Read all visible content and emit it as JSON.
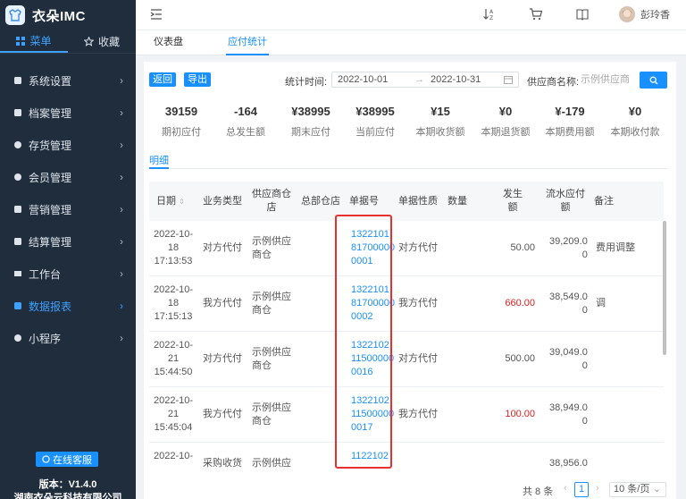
{
  "app": {
    "name": "衣朵IMC"
  },
  "sidebar": {
    "tabs": [
      {
        "label": "菜单",
        "icon": "grid-icon"
      },
      {
        "label": "收藏",
        "icon": "star-icon"
      }
    ],
    "items": [
      {
        "label": "系统设置",
        "icon": "settings-icon"
      },
      {
        "label": "档案管理",
        "icon": "archive-icon"
      },
      {
        "label": "存货管理",
        "icon": "inventory-icon"
      },
      {
        "label": "会员管理",
        "icon": "member-icon"
      },
      {
        "label": "营销管理",
        "icon": "marketing-icon"
      },
      {
        "label": "结算管理",
        "icon": "settlement-icon"
      },
      {
        "label": "工作台",
        "icon": "workbench-icon"
      },
      {
        "label": "数据报表",
        "icon": "report-icon"
      },
      {
        "label": "小程序",
        "icon": "miniprogram-icon"
      }
    ],
    "active_item": "数据报表",
    "support_label": "在线客服",
    "version": "版本：V1.4.0",
    "company": "湖南衣朵云科技有限公司"
  },
  "header": {
    "user_name": "彭玲香"
  },
  "page_tabs": [
    {
      "label": "仪表盘"
    },
    {
      "label": "应付统计"
    }
  ],
  "toolbar": {
    "back_label": "返回",
    "export_label": "导出",
    "period_label": "统计时间:",
    "date_start": "2022-10-01",
    "date_end": "2022-10-31",
    "supplier_label": "供应商名称:",
    "supplier_placeholder": "示例供应商"
  },
  "stats": [
    {
      "value": "39159",
      "label": "期初应付"
    },
    {
      "value": "-164",
      "label": "总发生额"
    },
    {
      "value": "¥38995",
      "label": "期末应付"
    },
    {
      "value": "¥38995",
      "label": "当前应付"
    },
    {
      "value": "¥15",
      "label": "本期收货额"
    },
    {
      "value": "¥0",
      "label": "本期退货额"
    },
    {
      "value": "¥-179",
      "label": "本期费用额"
    },
    {
      "value": "¥0",
      "label": "本期收付款"
    }
  ],
  "detail_tab": "明细",
  "table": {
    "columns": {
      "date": "日期",
      "biz_type": "业务类型",
      "supplier": "供应商仓店",
      "hq_store": "总部仓店",
      "doc_no": "单据号",
      "doc_type": "单据性质",
      "qty": "数量",
      "amount": "发生额",
      "balance": "流水应付额",
      "remark": "备注"
    },
    "rows": [
      {
        "date": [
          "2022-10-",
          "18",
          "17:13:53"
        ],
        "biz_type": "对方代付",
        "supplier": [
          "示例供应",
          "商仓"
        ],
        "doc_no": [
          "1322101",
          "81700000",
          "0001"
        ],
        "doc_type": "对方代付",
        "amount": "50.00",
        "amount_negative": false,
        "balance": [
          "39,209.0",
          "0"
        ],
        "remark": "费用调整"
      },
      {
        "date": [
          "2022-10-",
          "18",
          "17:15:13"
        ],
        "biz_type": "我方代付",
        "supplier": [
          "示例供应",
          "商仓"
        ],
        "doc_no": [
          "1322101",
          "81700000",
          "0002"
        ],
        "doc_type": "我方代付",
        "amount": "660.00",
        "amount_negative": true,
        "balance": [
          "38,549.0",
          "0"
        ],
        "remark": "调"
      },
      {
        "date": [
          "2022-10-",
          "21",
          "15:44:50"
        ],
        "biz_type": "对方代付",
        "supplier": [
          "示例供应",
          "商仓"
        ],
        "doc_no": [
          "1322102",
          "11500000",
          "0016"
        ],
        "doc_type": "对方代付",
        "amount": "500.00",
        "amount_negative": false,
        "balance": [
          "39,049.0",
          "0"
        ],
        "remark": ""
      },
      {
        "date": [
          "2022-10-",
          "21",
          "15:45:04"
        ],
        "biz_type": "我方代付",
        "supplier": [
          "示例供应",
          "商仓"
        ],
        "doc_no": [
          "1322102",
          "11500000",
          "0017"
        ],
        "doc_type": "我方代付",
        "amount": "100.00",
        "amount_negative": true,
        "balance": [
          "38,949.0",
          "0"
        ],
        "remark": ""
      },
      {
        "date": [
          "2022-10-",
          "",
          ""
        ],
        "biz_type": "采购收货",
        "supplier": [
          "示例供应",
          ""
        ],
        "doc_no": [
          "1122102",
          "",
          ""
        ],
        "doc_type": "",
        "amount": "",
        "amount_negative": false,
        "balance": [
          "38,956.0",
          ""
        ],
        "remark": ""
      }
    ]
  },
  "pager": {
    "total": "共 8 条",
    "current_page": "1",
    "page_size": "10 条/页"
  },
  "colors": {
    "accent": "#1890ff",
    "sidebar_bg": "#1f2d3d",
    "negative": "#e02020",
    "highlight": "#e8312f"
  }
}
